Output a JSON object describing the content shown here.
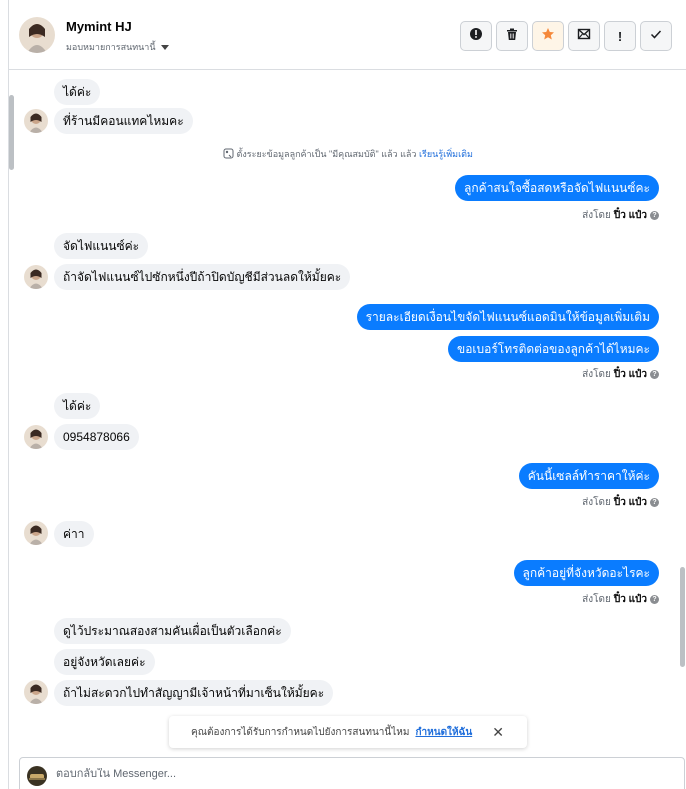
{
  "header": {
    "name": "Mymint HJ",
    "assign_label": "มอบหมายการสนทนานี้",
    "actions": [
      {
        "icon": "alert-icon",
        "symbol": "!"
      },
      {
        "icon": "trash-icon"
      },
      {
        "icon": "star-icon"
      },
      {
        "icon": "unread-mail-icon"
      },
      {
        "icon": "spam-icon",
        "symbol": "!"
      },
      {
        "icon": "check-icon"
      }
    ]
  },
  "messages": {
    "m1": "ได้ค่ะ",
    "m2": "ที่ร้านมีคอนแทคไหมคะ",
    "system_note": "ตั้งระยะข้อมูลลูกค้าเป็น \"มีคุณสมบัติ\" แล้ว",
    "system_link": "เรียนรู้เพิ่มเติม",
    "o1": "ลูกค้าสนใจซื้อสดหรือจัดไฟแนนซ์คะ",
    "sent_by_label": "ส่งโดย",
    "sent_by_name": "ปิ๋ว แป๋ว",
    "m3": "จัดไฟแนนซ์ค่ะ",
    "m4": "ถ้าจัดไฟแนนซ์ไปซักหนึ่งปีถ้าปิดบัญชีมีส่วนลดให้มั้ยคะ",
    "o2": "รายละเอียดเงื่อนไขจัดไฟแนนซ์แอดมินให้ข้อมูลเพิ่มเติม",
    "o3": "ขอเบอร์โทรติดต่อของลูกค้าได้ไหมคะ",
    "m5": "ได้ค่ะ",
    "m6": "0954878066",
    "o4": "คันนี้เซลล์ทำราคาให้ค่ะ",
    "m7": "ค่าา",
    "o5": "ลูกค้าอยู่ที่จังหวัดอะไรคะ",
    "m8": "ดูไว้ประมาณสองสามคันเผื่อเป็นตัวเลือกค่ะ",
    "m9": "อยู่จังหวัดเลยค่ะ",
    "m10": "ถ้าไม่สะดวกไปทำสัญญามีเจ้าหน้าที่มาเซ็นให้มั้ยคะ"
  },
  "toast": {
    "text": "คุณต้องการได้รับการกำหนดไปยังการสนทนานี้ไหม",
    "link": "กำหนดให้ฉัน"
  },
  "composer": {
    "placeholder": "ตอบกลับใน Messenger..."
  },
  "colors": {
    "outgoing": "#0a7cff",
    "incoming": "#f0f2f5",
    "star": "#f5883a"
  }
}
